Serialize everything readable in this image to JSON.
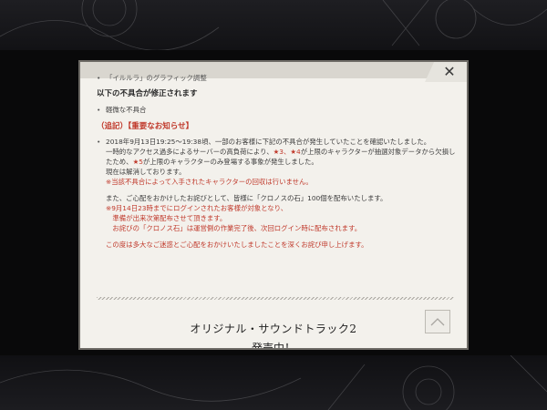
{
  "dialog": {
    "close_label": "✕",
    "truncated_top_item": "「イルルラ」のグラフィック調整",
    "bugfix_heading": "以下の不具合が修正されます",
    "bugfix_items": [
      "軽微な不具合"
    ],
    "notice_heading": "（追記）【重要なお知らせ】",
    "notice": {
      "line1": "2018年9月13日19:25〜19:38頃、一部のお客様に下記の不具合が発生していたことを確認いたしました。",
      "line2": "一時的なアクセス過多によるサーバーの高負荷により、",
      "line2_red1": "★3、★4",
      "line2b": "が上限のキャラクターが抽選対象データから欠損したため、",
      "line2_red2": "★5",
      "line2c": "が上限のキャラクターのみ登場する事象が発生しました。",
      "line3": "現在は解消しております。",
      "line4": "※当該不具合によって入手されたキャラクターの回収は行いません。",
      "line5": "また、ご心配をおかけしたお詫びとして、皆様に「クロノスの石」100個を配布いたします。",
      "line6": "※9月14日23時までにログインされたお客様が対象となり、",
      "line7": "　準備が出来次第配布させて頂きます。",
      "line8": "　お詫びの「クロノス石」は運営側の作業完了後、次回ログイン時に配布されます。",
      "line9": "この度は多大なご迷惑とご心配をおかけいたしましたことを深くお詫び申し上げます。"
    },
    "banner_title": "オリジナル・サウンドトラック2",
    "banner_subtitle": "発売中！"
  }
}
